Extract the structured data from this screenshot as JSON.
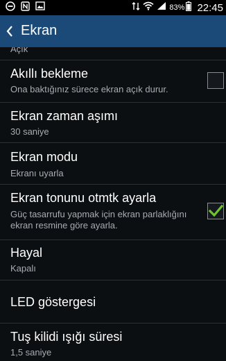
{
  "status_bar": {
    "icons_left": [
      "do-not-disturb-icon",
      "nfc-icon",
      "image-icon"
    ],
    "icons_right": [
      "sync-icon",
      "wifi-icon",
      "signal-icon",
      "battery-icon"
    ],
    "battery": "83%",
    "time": "22:45"
  },
  "action_bar": {
    "title": "Ekran"
  },
  "list": {
    "partial_top_summary": "Açık",
    "items": [
      {
        "title": "Akıllı bekleme",
        "summary": "Ona baktığınız sürece ekran açık durur.",
        "checked": false
      },
      {
        "title": "Ekran zaman aşımı",
        "summary": "30 saniye"
      },
      {
        "title": "Ekran modu",
        "summary": "Ekranı uyarla"
      },
      {
        "title": "Ekran tonunu otmtk ayarla",
        "summary": "Güç tasarrufu yapmak için ekran parlaklığını ekran resmine göre ayarla.",
        "checked": true
      },
      {
        "title": "Hayal",
        "summary": "Kapalı"
      },
      {
        "title": "LED göstergesi"
      },
      {
        "title": "Tuş kilidi ışığı süresi",
        "summary": "1,5 saniye"
      }
    ]
  },
  "colors": {
    "action_bar": "#1c4a78",
    "background": "#0c0f12",
    "checkmark": "#6cc52a"
  }
}
